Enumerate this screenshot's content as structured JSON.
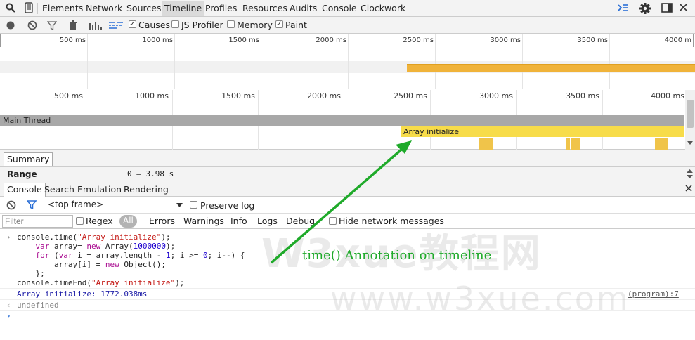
{
  "tabs": [
    {
      "label": "Elements"
    },
    {
      "label": "Network"
    },
    {
      "label": "Sources"
    },
    {
      "label": "Timeline"
    },
    {
      "label": "Profiles"
    },
    {
      "label": "Resources"
    },
    {
      "label": "Audits"
    },
    {
      "label": "Console"
    },
    {
      "label": "Clockwork"
    }
  ],
  "toolbar": {
    "causes_label": "Causes",
    "jsprofiler_label": "JS Profiler",
    "memory_label": "Memory",
    "paint_label": "Paint",
    "causes_checked": true,
    "jsprofiler_checked": false,
    "memory_checked": false,
    "paint_checked": true
  },
  "overview_ticks": [
    "500 ms",
    "1000 ms",
    "1500 ms",
    "2000 ms",
    "2500 ms",
    "3000 ms",
    "3500 ms",
    "4000 m"
  ],
  "detail_ticks": [
    "500 ms",
    "1000 ms",
    "1500 ms",
    "2000 ms",
    "2500 ms",
    "3000 ms",
    "3500 ms",
    "4000 ms"
  ],
  "timeline": {
    "thread_label": "Main Thread",
    "event_label": "Array initialize",
    "accent_color": "#f7dc4a",
    "thread_color": "#a8a8a8"
  },
  "summary": {
    "tab_label": "Summary",
    "range_label": "Range",
    "range_value": "0 – 3.98 s"
  },
  "drawer_tabs": [
    {
      "label": "Console"
    },
    {
      "label": "Search"
    },
    {
      "label": "Emulation"
    },
    {
      "label": "Rendering"
    }
  ],
  "console_toolbar": {
    "frame_select": "<top frame>",
    "preserve_log_label": "Preserve log",
    "filter_placeholder": "Filter",
    "regex_label": "Regex",
    "levels": [
      "All",
      "Errors",
      "Warnings",
      "Info",
      "Logs",
      "Debug"
    ],
    "hide_network_label": "Hide network messages"
  },
  "console": {
    "output_line": "Array initialize: 1772.038ms",
    "output_source": "(program):7",
    "result": "undefined"
  },
  "annotation": {
    "text": "time() Annotation on timeline",
    "color": "#1faa2a"
  },
  "watermark": {
    "cn": "W3xue教程网",
    "url": "www.w3xue.com"
  }
}
